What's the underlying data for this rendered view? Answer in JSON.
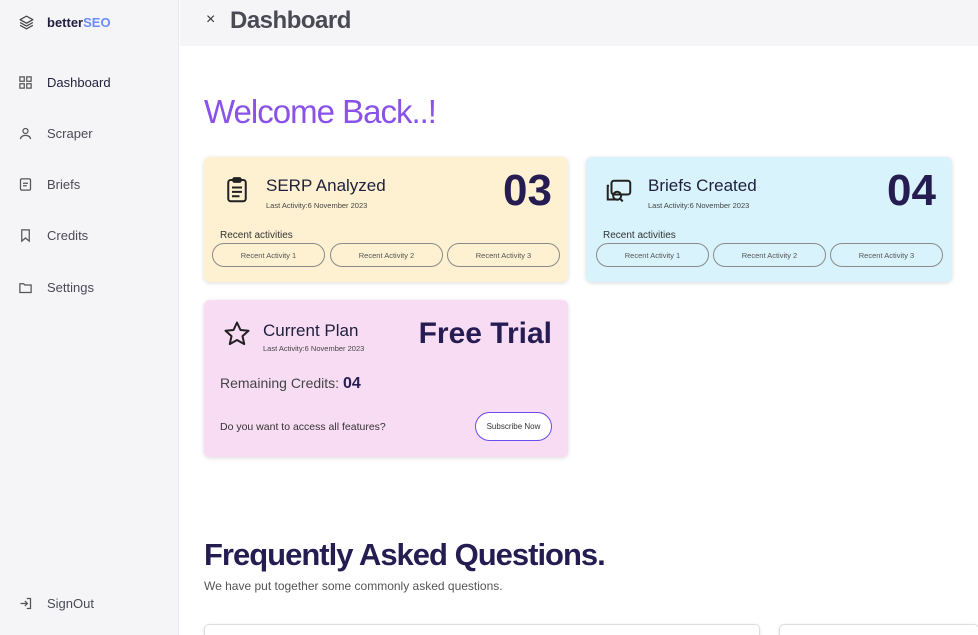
{
  "sidebar": {
    "brand": {
      "name_a": "better",
      "name_b": "SEO",
      "icon": "layers-icon"
    },
    "items": [
      {
        "label": "Dashboard",
        "icon": "grid-icon"
      },
      {
        "label": "Scraper",
        "icon": "user-icon"
      },
      {
        "label": "Briefs",
        "icon": "document-icon"
      },
      {
        "label": "Credits",
        "icon": "bookmark-icon"
      },
      {
        "label": "Settings",
        "icon": "folder-icon"
      }
    ],
    "signout": {
      "label": "SignOut",
      "icon": "signout-icon"
    }
  },
  "topbar": {
    "close": "×",
    "title": "Dashboard"
  },
  "welcome": "Welcome Back..!",
  "cards": {
    "serp": {
      "title": "SERP Analyzed",
      "subtitle": "Last Activity:6 November 2023",
      "count": "03",
      "recent_label": "Recent activities",
      "activities": [
        "Recent Activity 1",
        "Recent Activity 2",
        "Recent Activity 3"
      ]
    },
    "briefs": {
      "title": "Briefs Created",
      "subtitle": "Last Activity:6 November 2023",
      "count": "04",
      "recent_label": "Recent activities",
      "activities": [
        "Recent Activity 1",
        "Recent Activity 2",
        "Recent Activity 3"
      ]
    },
    "plan": {
      "title": "Current Plan",
      "subtitle": "Last Activity:6 November 2023",
      "plan_name": "Free Trial",
      "credits_label": "Remaining Credits:",
      "credits_value": "04",
      "question": "Do you want to access all features?",
      "subscribe": "Subscribe Now"
    }
  },
  "faq": {
    "title": "Frequently Asked Questions.",
    "subtitle": "We have put together some commonly asked questions."
  },
  "colors": {
    "accent": "#8a52e8",
    "dark_navy": "#251c52",
    "serp_bg": "#fdf1d2",
    "briefs_bg": "#d8f3fb",
    "plan_bg": "#f8dcf3"
  }
}
